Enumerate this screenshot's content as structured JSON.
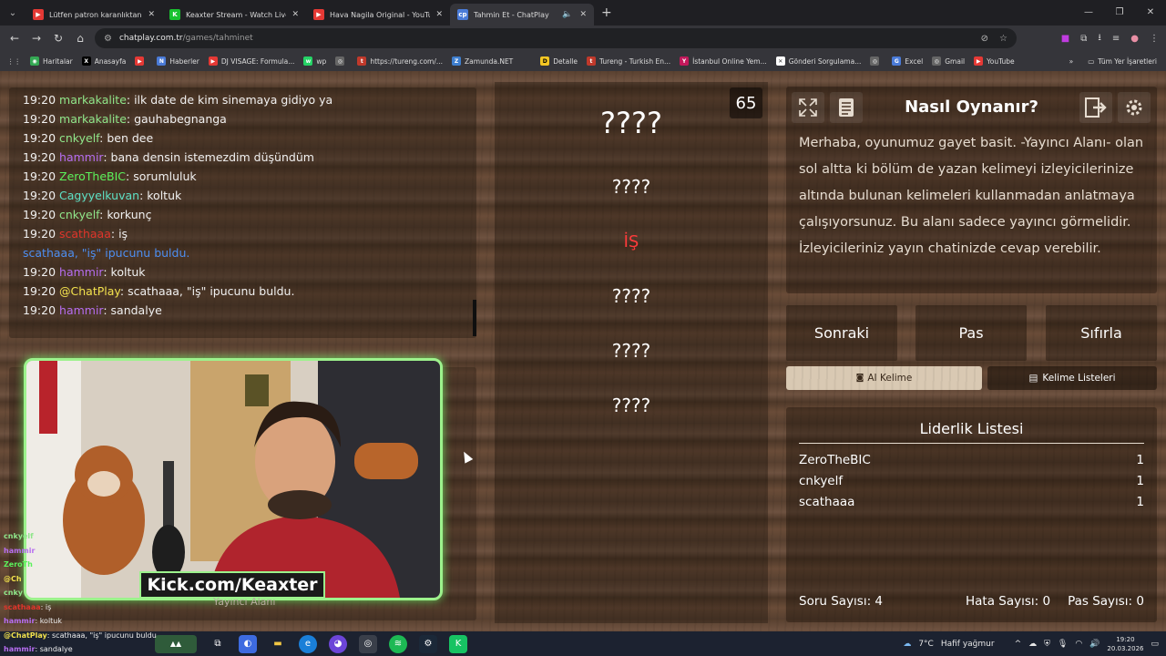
{
  "browser": {
    "tabs": [
      {
        "title": "Lütfen patron karanlıktan korku",
        "icon_color": "#e53935",
        "active": false
      },
      {
        "title": "Keaxter Stream - Watch Live on",
        "icon_color": "#19c12f",
        "active": false
      },
      {
        "title": "Hava Nagila Original - YouTube",
        "icon_color": "#e53935",
        "active": false
      },
      {
        "title": "Tahmin Et - ChatPlay",
        "icon_color": "#4a7bd8",
        "active": true
      }
    ],
    "url_host": "chatplay.com.tr",
    "url_path": "/games/tahminet",
    "bookmarks": [
      "Haritalar",
      "Anasayfa",
      "Haberler",
      "DJ VISAGE: Formula...",
      "wp",
      "https://tureng.com/...",
      "Zamunda.NET",
      "Detalle",
      "Tureng - Turkish En...",
      "İstanbul Online Yem...",
      "Gönderi Sorgulama...",
      "Excel",
      "Gmail",
      "YouTube"
    ],
    "all_bookmarks": "Tüm Yer İşaretleri"
  },
  "chat": {
    "lines": [
      {
        "time": "19:20",
        "user": "markakalite",
        "color": "#8fe68a",
        "msg": "ilk date de kim sinemaya gidiyo ya"
      },
      {
        "time": "19:20",
        "user": "markakalite",
        "color": "#8fe68a",
        "msg": "gauhabegnanga"
      },
      {
        "time": "19:20",
        "user": "cnkyelf",
        "color": "#8fe68a",
        "msg": "ben dee"
      },
      {
        "time": "19:20",
        "user": "hammir",
        "color": "#b66df0",
        "msg": "bana densin istemezdim düşündüm"
      },
      {
        "time": "19:20",
        "user": "ZeroTheBIC",
        "color": "#5bf15b",
        "msg": "sorumluluk"
      },
      {
        "time": "19:20",
        "user": "Cagyyelkuvan",
        "color": "#5de0c4",
        "msg": "koltuk"
      },
      {
        "time": "19:20",
        "user": "cnkyelf",
        "color": "#8fe68a",
        "msg": "korkunç"
      },
      {
        "time": "19:20",
        "user": "scathaaa",
        "color": "#e0352b",
        "msg": "iş"
      },
      {
        "time": "",
        "user": "",
        "color": "",
        "msg": "",
        "system": "scathaaa, \"iş\" ipucunu buldu."
      },
      {
        "time": "19:20",
        "user": "hammir",
        "color": "#b66df0",
        "msg": "koltuk"
      },
      {
        "time": "19:20",
        "user": "@ChatPlay",
        "color": "#f2e14d",
        "msg": "scathaaa, \"iş\" ipucunu buldu."
      },
      {
        "time": "19:20",
        "user": "hammir",
        "color": "#b66df0",
        "msg": "sandalye"
      }
    ]
  },
  "overlay_chat": [
    {
      "user": "cnkyelf",
      "color": "#8fe68a",
      "msg": ""
    },
    {
      "user": "hammir",
      "color": "#b66df0",
      "msg": ""
    },
    {
      "user": "ZeroTh",
      "color": "#5bf15b",
      "msg": ""
    },
    {
      "user": "@Ch",
      "color": "#f2e14d",
      "msg": ""
    },
    {
      "user": "cnky",
      "color": "#8fe68a",
      "msg": ""
    },
    {
      "user": "scathaaa",
      "color": "#e0352b",
      "msg": "iş"
    },
    {
      "user": "hammir",
      "color": "#b66df0",
      "msg": "koltuk"
    },
    {
      "user": "@ChatPlay",
      "color": "#f2e14d",
      "msg": "scathaaa, \"iş\" ipucunu buldu"
    },
    {
      "user": "hammir",
      "color": "#b66df0",
      "msg": "sandalye"
    }
  ],
  "stream": {
    "label": "Kick.com/Keaxter",
    "area_label": "Yayıncı Alanı"
  },
  "game": {
    "timer": "65",
    "main_word": "????",
    "words": [
      "????",
      "İŞ",
      "????",
      "????",
      "????"
    ]
  },
  "how_to": {
    "title": "Nasıl Oynanır?",
    "text": "Merhaba, oyunumuz gayet basit. -Yayıncı Alanı- olan sol altta ki bölüm de yazan kelimeyi izleyicilerinize altında bulunan kelimeleri kullanmadan anlatmaya çalışıyorsunuz. Bu alanı sadece yayıncı görmelidir. İzleyicileriniz yayın chatinizde cevap verebilir."
  },
  "buttons": {
    "next": "Sonraki",
    "pass": "Pas",
    "reset": "Sıfırla"
  },
  "small_buttons": {
    "ai": "AI Kelime",
    "lists": "Kelime Listeleri"
  },
  "leaderboard": {
    "title": "Liderlik Listesi",
    "rows": [
      {
        "name": "ZeroTheBIC",
        "score": "1"
      },
      {
        "name": "cnkyelf",
        "score": "1"
      },
      {
        "name": "scathaaa",
        "score": "1"
      }
    ],
    "soru": "Soru Sayısı: 4",
    "hata": "Hata Sayısı: 0",
    "pas": "Pas Sayısı: 0"
  },
  "taskbar": {
    "weather": "7°C",
    "weather_desc": "Hafif yağmur",
    "time": "19:20",
    "date": "20.03.2026"
  }
}
